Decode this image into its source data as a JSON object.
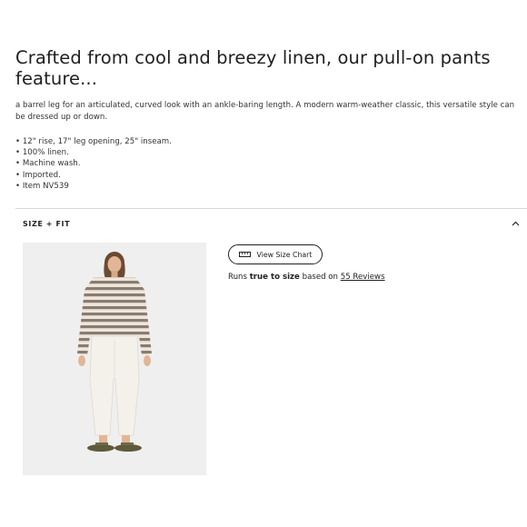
{
  "product": {
    "headline": "Crafted from cool and breezy linen, our pull-on pants feature...",
    "description": "a barrel leg for an articulated, curved look with an ankle-baring length. A modern warm-weather classic, this versatile style can be dressed up or down.",
    "details": [
      "12\" rise, 17\" leg opening, 25\" inseam.",
      "100% linen.",
      "Machine wash.",
      "Imported.",
      "Item NV539"
    ]
  },
  "size_fit": {
    "section_title": "SIZE + FIT",
    "chevron_icon": "chevron-up-icon",
    "size_chart_label": "View Size Chart",
    "ruler_icon": "ruler-icon",
    "fit_prefix": "Runs",
    "fit_value": "true to size",
    "fit_middle": "based on",
    "reviews_link": "55 Reviews"
  },
  "colors": {
    "text": "#222222",
    "divider": "#d6d6d6",
    "photo_bg": "#efefef",
    "sweater_stripe": "#8b7b6e",
    "pants": "#f4f1ea"
  }
}
